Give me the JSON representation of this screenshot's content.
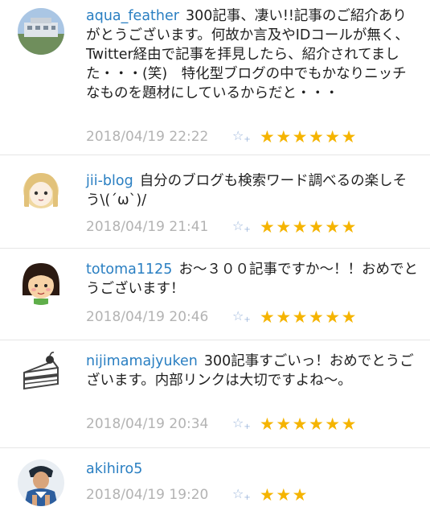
{
  "colors": {
    "username": "#2a7fc2",
    "date": "#b3b3b3",
    "star": "#f5b400",
    "add_star": "#9fb8dc"
  },
  "add_star_icon": {
    "glyph": "☆",
    "plus": "+"
  },
  "comments": [
    {
      "avatar": "photo-avatar",
      "user": "aqua_feather",
      "text": "300記事、凄い!!記事のご紹介ありがとうございます。何故か言及やIDコールが無く、Twitter経由で記事を拝見したら、紹介されてました・・・(笑)　特化型ブログの中でもかなりニッチなものを題材にしているからだと・・・",
      "date": "2018/04/19 22:22",
      "stars": "★★★★★★",
      "star_count": 6
    },
    {
      "avatar": "anime-girl-avatar",
      "user": "jii-blog",
      "text": "自分のブログも検索ワード調べるの楽しそう\\(´ω`)/",
      "date": "2018/04/19 21:41",
      "stars": "★★★★★★",
      "star_count": 6
    },
    {
      "avatar": "bob-hair-avatar",
      "user": "totoma1125",
      "text": "お～３００記事ですか～！！おめでとうございます！",
      "date": "2018/04/19 20:46",
      "stars": "★★★★★★",
      "star_count": 6
    },
    {
      "avatar": "cake-icon",
      "user": "nijimamajyuken",
      "text": "300記事すごいっ！おめでとうございます。内部リンクは大切ですよね～。",
      "date": "2018/04/19 20:34",
      "stars": "★★★★★★",
      "star_count": 6
    },
    {
      "avatar": "illustration-avatar",
      "user": "akihiro5",
      "text": "",
      "date": "2018/04/19 19:20",
      "stars": "★★★",
      "star_count": 3
    }
  ]
}
